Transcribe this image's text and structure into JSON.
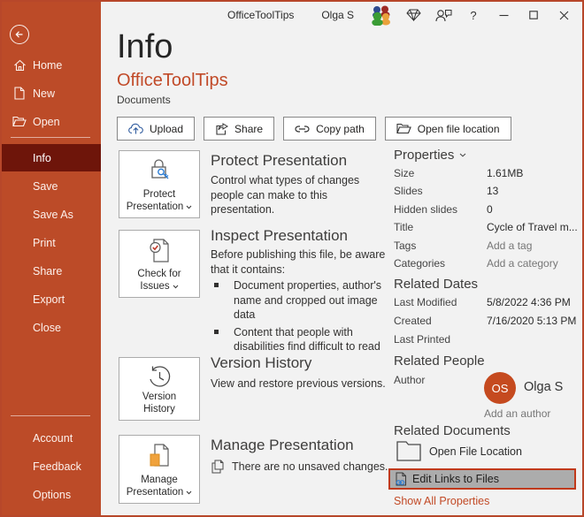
{
  "window": {
    "title": "OfficeToolTips"
  },
  "titlebar": {
    "user_name": "Olga S",
    "help_label": "?"
  },
  "sidebar": {
    "top_items": [
      {
        "label": "Home"
      },
      {
        "label": "New"
      },
      {
        "label": "Open"
      }
    ],
    "menu_items": [
      "Info",
      "Save",
      "Save As",
      "Print",
      "Share",
      "Export",
      "Close"
    ],
    "selected_item": "Info",
    "bottom_items": [
      "Account",
      "Feedback",
      "Options"
    ]
  },
  "header": {
    "page_title": "Info",
    "document_title": "OfficeToolTips",
    "location": "Documents"
  },
  "toolbar": {
    "upload": "Upload",
    "share": "Share",
    "copy_path": "Copy path",
    "open_file_location": "Open file location"
  },
  "sections": [
    {
      "button_line1": "Protect",
      "button_line2": "Presentation",
      "heading": "Protect Presentation",
      "description": "Control what types of changes people can make to this presentation."
    },
    {
      "button_line1": "Check for",
      "button_line2": "Issues",
      "heading": "Inspect Presentation",
      "description": "Before publishing this file, be aware that it contains:",
      "bullets": [
        "Document properties, author's name and cropped out image data",
        "Content that people with disabilities find difficult to read"
      ]
    },
    {
      "button_line1": "Version",
      "button_line2": "History",
      "heading": "Version History",
      "description": "View and restore previous versions."
    },
    {
      "button_line1": "Manage",
      "button_line2": "Presentation",
      "heading": "Manage Presentation",
      "status": "There are no unsaved changes."
    }
  ],
  "properties": {
    "heading": "Properties",
    "rows": [
      {
        "label": "Size",
        "value": "1.61MB"
      },
      {
        "label": "Slides",
        "value": "13"
      },
      {
        "label": "Hidden slides",
        "value": "0"
      },
      {
        "label": "Title",
        "value": "Cycle of Travel m..."
      },
      {
        "label": "Tags",
        "value": "Add a tag"
      },
      {
        "label": "Categories",
        "value": "Add a category"
      }
    ]
  },
  "related_dates": {
    "heading": "Related Dates",
    "rows": [
      {
        "label": "Last Modified",
        "value": "5/8/2022 4:36 PM"
      },
      {
        "label": "Created",
        "value": "7/16/2020 5:13 PM"
      },
      {
        "label": "Last Printed",
        "value": ""
      }
    ]
  },
  "related_people": {
    "heading": "Related People",
    "author_label": "Author",
    "author_initials": "OS",
    "author_name": "Olga S",
    "add_author": "Add an author"
  },
  "related_documents": {
    "heading": "Related Documents",
    "open_file_location": "Open File Location",
    "edit_links": "Edit Links to Files"
  },
  "footer": {
    "show_all_properties": "Show All Properties"
  },
  "colors": {
    "accent": "#B7472A",
    "sidebar_bg": "#BC4B28",
    "sidebar_selected_bg": "#6E150A",
    "accent_text": "#C24A26",
    "avatar_bg": "#C54A1F",
    "highlight_bg": "#ACACAC",
    "highlight_border": "#C0391B",
    "key_blue": "#2B7CD3",
    "check_red": "#C0392B",
    "manage_orange": "#F0A23C"
  }
}
